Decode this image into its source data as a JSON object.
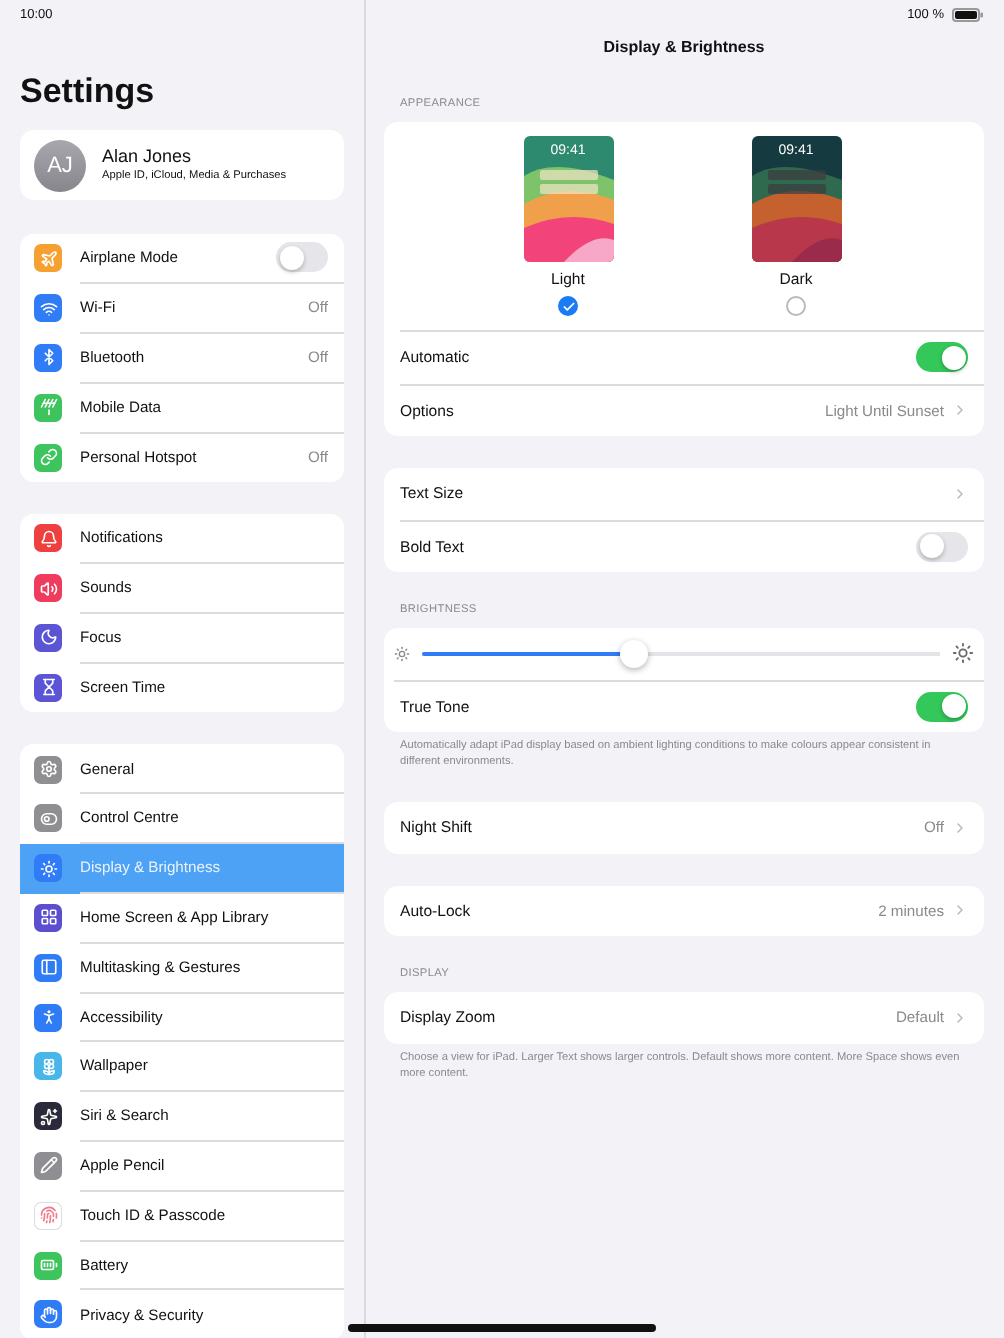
{
  "status_bar": {
    "time": "10:00",
    "battery": "100 %"
  },
  "sidebar": {
    "title": "Settings",
    "profile": {
      "initials": "AJ",
      "name": "Alan Jones",
      "subtitle": "Apple ID, iCloud, Media & Purchases"
    },
    "groups": [
      [
        {
          "label": "Airplane Mode",
          "kind": "toggle",
          "on": false,
          "selected": false,
          "color": "#f7a032"
        },
        {
          "label": "Wi-Fi",
          "kind": "value",
          "value": "Off",
          "selected": false,
          "color": "#2f7cf6"
        },
        {
          "label": "Bluetooth",
          "kind": "value",
          "value": "Off",
          "selected": false,
          "color": "#2f7cf6"
        },
        {
          "label": "Mobile Data",
          "kind": "plain",
          "selected": false,
          "color": "#3dc45c"
        },
        {
          "label": "Personal Hotspot",
          "kind": "value",
          "value": "Off",
          "selected": false,
          "color": "#3dc45c"
        }
      ],
      [
        {
          "label": "Notifications",
          "kind": "plain",
          "selected": false,
          "color": "#ef4040"
        },
        {
          "label": "Sounds",
          "kind": "plain",
          "selected": false,
          "color": "#ef3b5c"
        },
        {
          "label": "Focus",
          "kind": "plain",
          "selected": false,
          "color": "#5b55d6"
        },
        {
          "label": "Screen Time",
          "kind": "plain",
          "selected": false,
          "color": "#5b55d6"
        }
      ],
      [
        {
          "label": "General",
          "kind": "plain",
          "selected": false,
          "color": "#8e8e93"
        },
        {
          "label": "Control Centre",
          "kind": "plain",
          "selected": false,
          "color": "#8e8e93"
        },
        {
          "label": "Display & Brightness",
          "kind": "plain",
          "selected": true,
          "color": "#2f7cf6"
        },
        {
          "label": "Home Screen & App Library",
          "kind": "plain",
          "selected": false,
          "color": "#5b4fd0"
        },
        {
          "label": "Multitasking & Gestures",
          "kind": "plain",
          "selected": false,
          "color": "#2f7cf6"
        },
        {
          "label": "Accessibility",
          "kind": "plain",
          "selected": false,
          "color": "#2f7cf6"
        },
        {
          "label": "Wallpaper",
          "kind": "plain",
          "selected": false,
          "color": "#48b6e8"
        },
        {
          "label": "Siri & Search",
          "kind": "plain",
          "selected": false,
          "color": "#2a2a3a"
        },
        {
          "label": "Apple Pencil",
          "kind": "plain",
          "selected": false,
          "color": "#8e8e93"
        },
        {
          "label": "Touch ID & Passcode",
          "kind": "plain",
          "selected": false,
          "color": "#ffffff"
        },
        {
          "label": "Battery",
          "kind": "plain",
          "selected": false,
          "color": "#3dc45c"
        },
        {
          "label": "Privacy & Security",
          "kind": "plain",
          "selected": false,
          "color": "#2f7cf6"
        }
      ]
    ]
  },
  "detail": {
    "title": "Display & Brightness",
    "sections": [
      {
        "header": "APPEARANCE",
        "items": [
          {
            "kind": "modes",
            "options": [
              {
                "label": "Light",
                "time": "09:41",
                "selected": true
              },
              {
                "label": "Dark",
                "time": "09:41",
                "selected": false
              }
            ]
          },
          {
            "kind": "toggle",
            "label": "Automatic",
            "on": true
          },
          {
            "kind": "link",
            "label": "Options",
            "value": "Light Until Sunset"
          }
        ]
      },
      {
        "items": [
          {
            "kind": "link",
            "label": "Text Size"
          },
          {
            "kind": "toggle",
            "label": "Bold Text",
            "on": false
          }
        ]
      },
      {
        "header": "BRIGHTNESS",
        "items": [
          {
            "kind": "slider",
            "level": 0.41
          },
          {
            "kind": "toggle",
            "label": "True Tone",
            "on": true
          }
        ],
        "footer": "Automatically adapt iPad display based on ambient lighting conditions to make colours appear consistent in different environments."
      },
      {
        "items": [
          {
            "kind": "link",
            "label": "Night Shift",
            "value": "Off"
          }
        ]
      },
      {
        "items": [
          {
            "kind": "link",
            "label": "Auto-Lock",
            "value": "2 minutes"
          }
        ]
      },
      {
        "header": "DISPLAY",
        "items": [
          {
            "kind": "link",
            "label": "Display Zoom",
            "value": "Default"
          }
        ],
        "footer": "Choose a view for iPad. Larger Text shows larger controls. Default shows more content. More Space shows even more content."
      }
    ]
  }
}
